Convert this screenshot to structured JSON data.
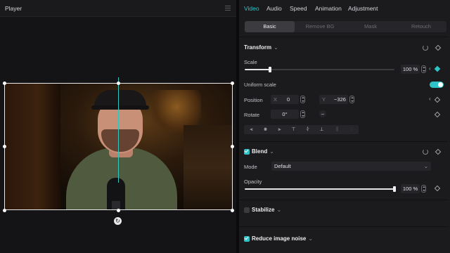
{
  "player": {
    "title": "Player"
  },
  "inspector": {
    "tabs": [
      "Video",
      "Audio",
      "Speed",
      "Animation",
      "Adjustment"
    ],
    "active_tab": "Video",
    "subtabs": [
      "Basic",
      "Remove BG",
      "Mask",
      "Retouch"
    ],
    "active_subtab": "Basic",
    "transform": {
      "title": "Transform",
      "scale_label": "Scale",
      "scale_value": "100 %",
      "scale_level": 0.17,
      "uniform_scale_label": "Uniform scale",
      "uniform_scale_on": true,
      "position_label": "Position",
      "x_prefix": "X",
      "x_value": "0",
      "y_prefix": "Y",
      "y_value": "−326",
      "rotate_label": "Rotate",
      "rotate_value": "0°",
      "rotate_flip": "–"
    },
    "blend": {
      "title": "Blend",
      "enabled": true,
      "mode_label": "Mode",
      "mode_value": "Default",
      "opacity_label": "Opacity",
      "opacity_value": "100 %",
      "opacity_level": 1.0
    },
    "stabilize": {
      "title": "Stabilize",
      "enabled": false
    },
    "noise": {
      "title": "Reduce image noise",
      "enabled": true
    }
  },
  "colors": {
    "accent": "#2ec4c7",
    "panel": "#1b1b1e",
    "player_bg": "#141416"
  },
  "icons": [
    "menu-icon",
    "reset-icon",
    "keyframe-icon",
    "rotate-icon",
    "align-left-icon",
    "align-center-icon",
    "align-right-icon",
    "align-top-icon",
    "align-middle-icon",
    "align-bottom-icon"
  ]
}
